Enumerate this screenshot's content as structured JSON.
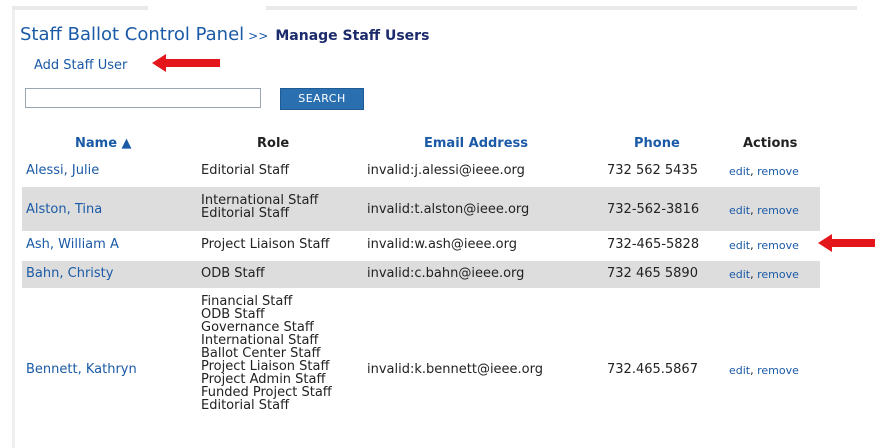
{
  "header": {
    "title": "Staff Ballot Control Panel",
    "separator": ">>",
    "subtitle": "Manage Staff Users"
  },
  "add_link": "Add Staff User",
  "search": {
    "value": "",
    "button_label": "SEARCH"
  },
  "table": {
    "columns": {
      "name": "Name ▲",
      "role": "Role",
      "email": "Email Address",
      "phone": "Phone",
      "actions": "Actions"
    },
    "rows": [
      {
        "name": "Alessi, Julie",
        "roles": [
          "Editorial Staff"
        ],
        "email": "invalid:j.alessi@ieee.org",
        "phone": "732 562 5435",
        "edit": "edit",
        "comma": ",",
        "remove": "remove"
      },
      {
        "name": "Alston, Tina",
        "roles": [
          "International Staff",
          "Editorial Staff"
        ],
        "email": "invalid:t.alston@ieee.org",
        "phone": "732-562-3816",
        "edit": "edit",
        "comma": ",",
        "remove": "remove"
      },
      {
        "name": "Ash, William A",
        "roles": [
          "Project Liaison Staff"
        ],
        "email": "invalid:w.ash@ieee.org",
        "phone": "732-465-5828",
        "edit": "edit",
        "comma": ",",
        "remove": "remove"
      },
      {
        "name": "Bahn, Christy",
        "roles": [
          "ODB Staff"
        ],
        "email": "invalid:c.bahn@ieee.org",
        "phone": "732 465 5890",
        "edit": "edit",
        "comma": ",",
        "remove": "remove"
      },
      {
        "name": "Bennett, Kathryn",
        "roles": [
          "Financial Staff",
          "ODB Staff",
          "Governance Staff",
          "International Staff",
          "Ballot Center Staff",
          "Project Liaison Staff",
          "Project Admin Staff",
          "Funded Project Staff",
          "Editorial Staff"
        ],
        "email": "invalid:k.bennett@ieee.org",
        "phone": "732.465.5867",
        "edit": "edit",
        "comma": ",",
        "remove": "remove"
      }
    ]
  },
  "colors": {
    "link": "#1a5aa6",
    "arrow": "#e4161b",
    "alt_row": "#dddddd",
    "search_button": "#2a6fb0"
  },
  "icons": {
    "arrow_1": "red-left-arrow-icon",
    "arrow_2": "red-left-arrow-icon"
  }
}
